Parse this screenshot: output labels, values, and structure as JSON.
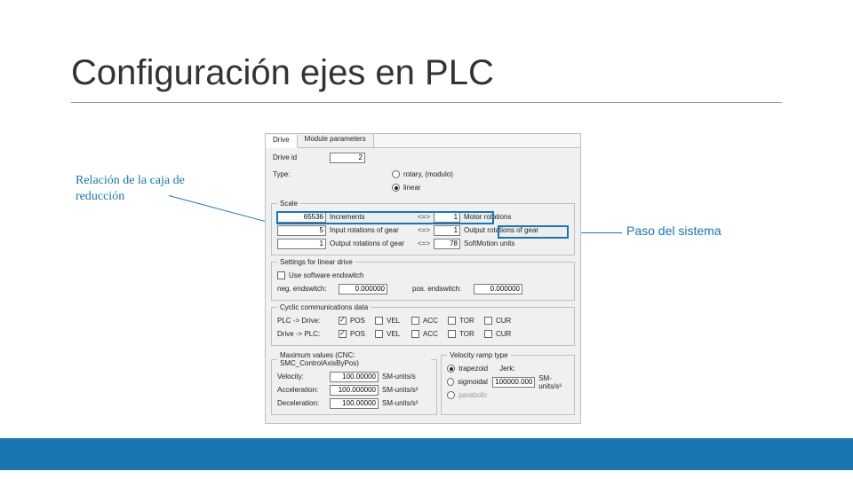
{
  "slide": {
    "title": "Configuración ejes en PLC"
  },
  "annotations": {
    "left": "Relación de la caja de reducción",
    "right": "Paso del sistema"
  },
  "panel": {
    "tabs": {
      "drive": "Drive",
      "module": "Module parameters"
    },
    "drive_id_label": "Drive id",
    "drive_id_value": "2",
    "type_label": "Type:",
    "type_rotary": "rotary, (modulo)",
    "type_linear": "linear",
    "scale": {
      "legend": "Scale",
      "increments": "65536",
      "increments_label": "Increments",
      "arrow": "<=>",
      "motor_rot": "1",
      "motor_rot_label": "Motor rotations",
      "input_rot": "5",
      "input_rot_label": "Input rotations of gear",
      "output_rot": "1",
      "output_rot_label": "Output rotations of gear",
      "output_rot2": "1",
      "output_rot2_label": "Output rotations of gear",
      "softmotion": "78",
      "softmotion_label": "SoftMotion units"
    },
    "linear": {
      "legend": "Settings for linear drive",
      "use_sw_label": "Use software endswitch",
      "neg_label": "neg. endswitch:",
      "neg_val": "0.000000",
      "pos_label": "pos. endswitch:",
      "pos_val": "0.000000"
    },
    "cyc": {
      "legend": "Cyclic communications data",
      "plc_drive": "PLC -> Drive:",
      "drive_plc": "Drive -> PLC:",
      "pos": "POS",
      "vel": "VEL",
      "acc": "ACC",
      "tor": "TOR",
      "cur": "CUR"
    },
    "max": {
      "legend": "Maximum values (CNC: SMC_ControlAxisByPos)",
      "velocity": "Velocity:",
      "velocity_val": "100.00000",
      "velocity_unit": "SM-units/s",
      "accel": "Acceleration:",
      "accel_val": "100.000000",
      "accel_unit": "SM-units/s²",
      "decel": "Deceleration:",
      "decel_val": "100.00000",
      "decel_unit": "SM-units/s²"
    },
    "ramp": {
      "legend": "Velocity ramp type",
      "trap": "trapezoid",
      "sig": "sigmoidal",
      "par": "parabolic",
      "jerk": "Jerk:",
      "jerk_val": "100000.000",
      "jerk_unit": "SM-units/s³"
    }
  }
}
